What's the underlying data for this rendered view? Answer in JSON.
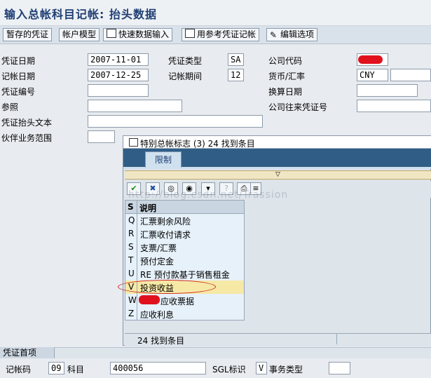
{
  "window": {
    "title": "输入总帐科目记帐: 抬头数据"
  },
  "toolbar": {
    "buttons": [
      {
        "label": "暂存的凭证",
        "icon": "none"
      },
      {
        "label": "帐户模型",
        "icon": "none"
      },
      {
        "label": "快速数据输入",
        "icon": "document-edit-icon"
      },
      {
        "label": "用参考凭证记帐",
        "icon": "document-copy-icon"
      },
      {
        "label": "编辑选项",
        "icon": "pencil-icon"
      }
    ]
  },
  "header": {
    "doc_date_label": "凭证日期",
    "doc_date": "2007-11-01",
    "doc_type_label": "凭证类型",
    "doc_type": "SA",
    "company_code_label": "公司代码",
    "post_date_label": "记帐日期",
    "post_date": "2007-12-25",
    "period_label": "记帐期间",
    "period": "12",
    "currency_label": "货币/汇率",
    "currency": "CNY",
    "doc_number_label": "凭证编号",
    "translation_date_label": "换算日期",
    "reference_label": "参照",
    "intercompany_label": "公司往来凭证号",
    "header_text_label": "凭证抬头文本",
    "partner_area_label": "伙伴业务范围"
  },
  "popup": {
    "title": "特别总帐标志 (3)   24 找到条目",
    "tab": "限制",
    "watermark": "http://blog.csdn.net/Trassion",
    "columns": {
      "key": "S",
      "desc": "说明"
    },
    "rows": [
      {
        "key": "Q",
        "desc": "汇票剩余风险",
        "selected": false
      },
      {
        "key": "R",
        "desc": "汇票收付请求",
        "selected": false
      },
      {
        "key": "S",
        "desc": "支票/汇票",
        "selected": false
      },
      {
        "key": "T",
        "desc": "预付定金",
        "selected": false
      },
      {
        "key": "U",
        "desc": "RE 预付款基于销售租金",
        "selected": false
      },
      {
        "key": "V",
        "desc": "投资收益",
        "selected": true
      },
      {
        "key": "W",
        "desc": "应收票据",
        "selected": false
      },
      {
        "key": "Z",
        "desc": "应收利息",
        "selected": false
      }
    ],
    "status": "24 找到条目",
    "toolbar_icons": [
      "checkmark-icon",
      "close-icon",
      "binoculars-icon",
      "binoculars-next-icon",
      "filter-icon",
      "help-icon",
      "print-icon",
      "list-icon"
    ]
  },
  "first_item": {
    "section_label": "凭证首项",
    "posting_key_label": "记帐码",
    "posting_key": "09",
    "account_label": "科目",
    "account": "400056",
    "sgl_label": "SGL标识",
    "sgl": "V",
    "trans_type_label": "事务类型"
  },
  "colors": {
    "title_blue": "#1f3e74",
    "selected_row": "#f6e9a6",
    "redaction": "#e0101c"
  }
}
